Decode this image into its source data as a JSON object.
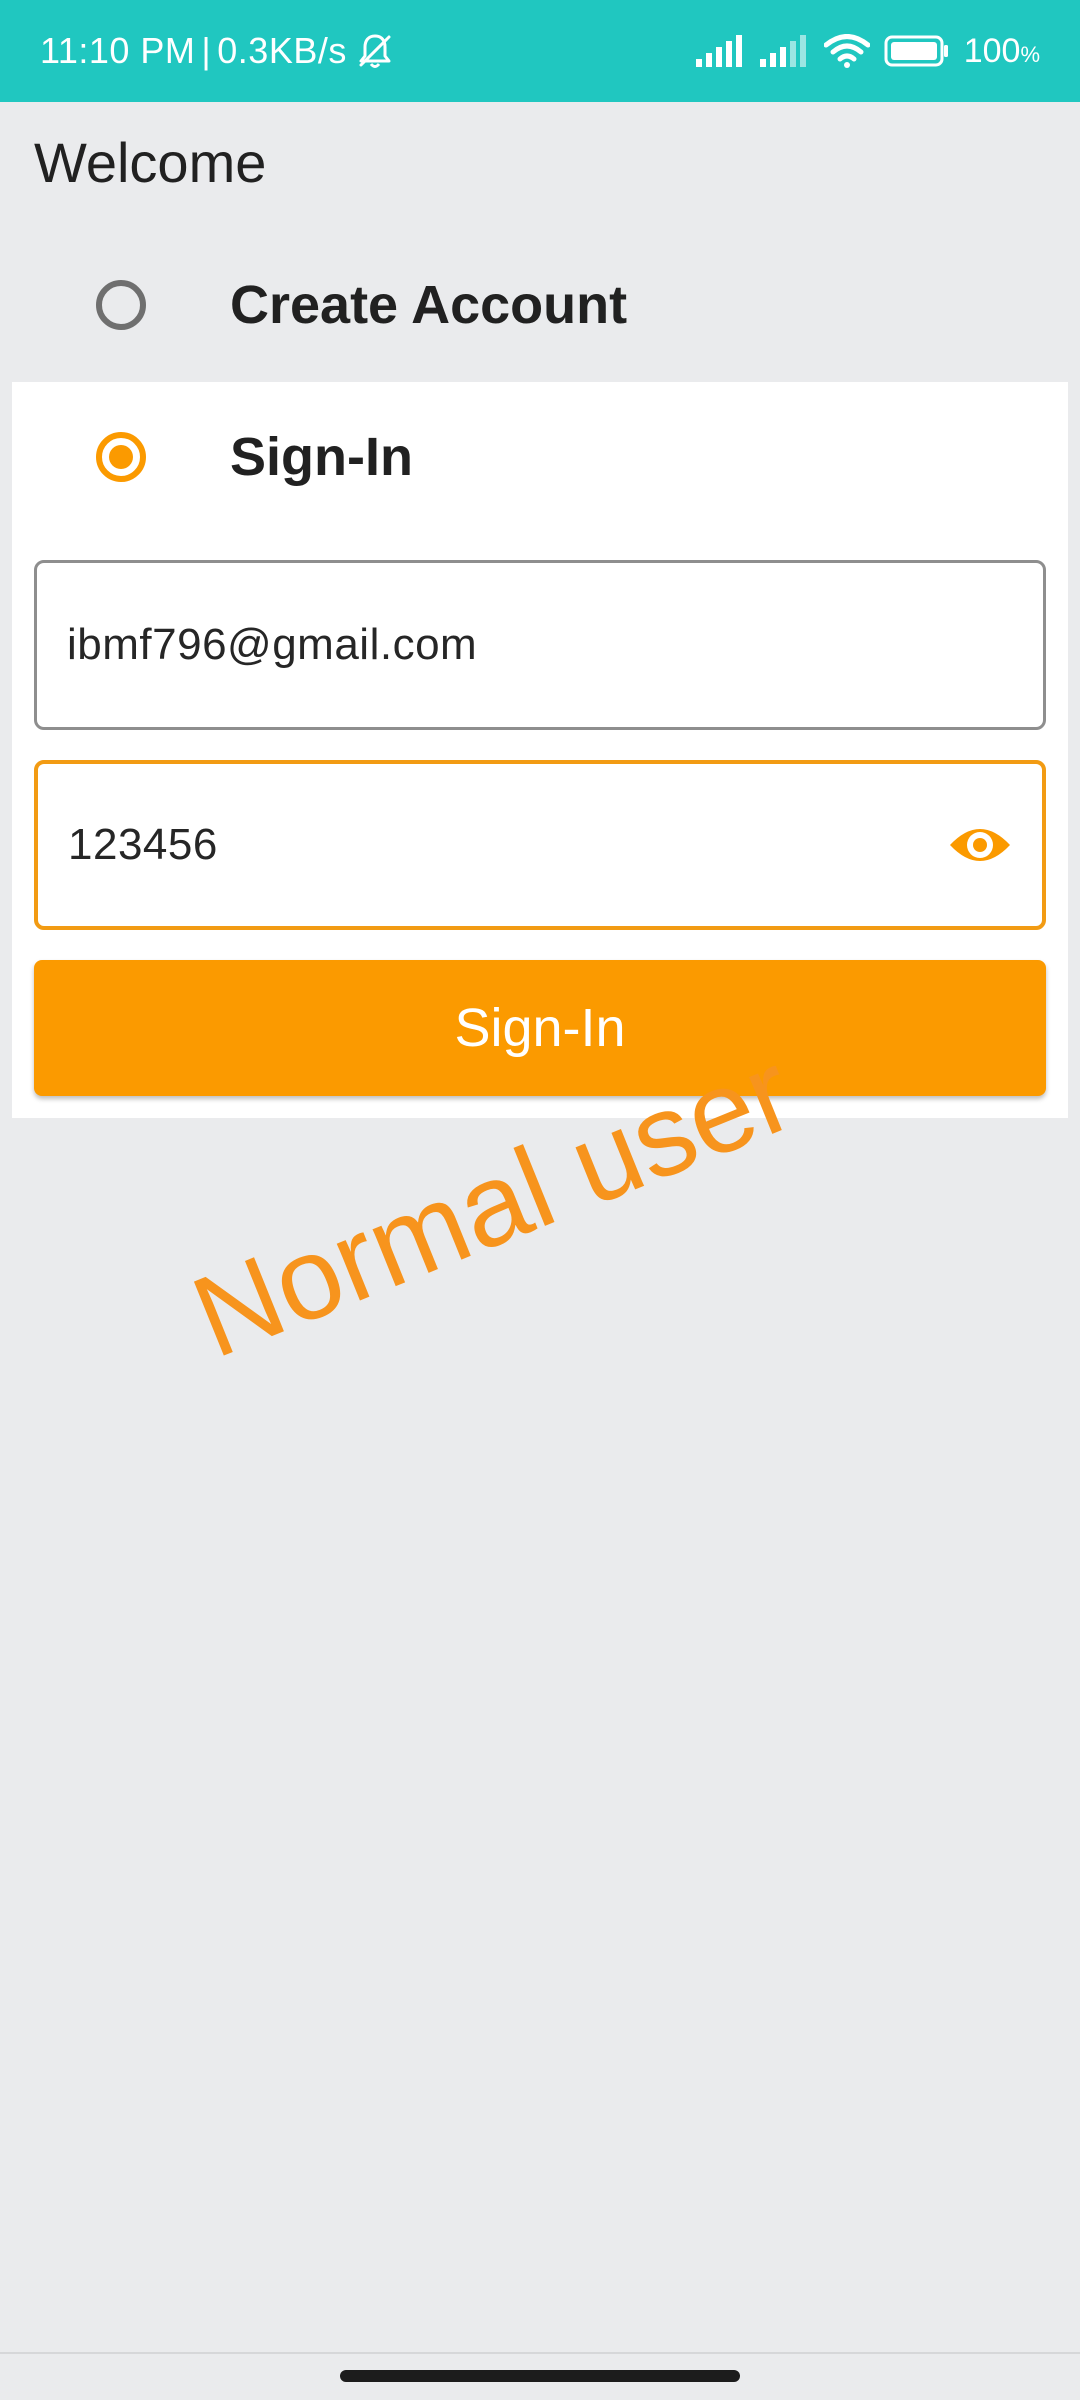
{
  "status_bar": {
    "time": "11:10 PM",
    "separator": "|",
    "network_speed": "0.3KB/s",
    "battery_percent": "100",
    "battery_unit": "%",
    "icons": [
      "bell-off-icon",
      "signal-icon",
      "signal-icon",
      "wifi-icon",
      "battery-icon"
    ]
  },
  "page": {
    "title": "Welcome"
  },
  "options": {
    "create_account": {
      "label": "Create Account",
      "selected": false
    },
    "sign_in": {
      "label": "Sign-In",
      "selected": true
    }
  },
  "form": {
    "email_value": "ibmf796@gmail.com",
    "password_value": "123456",
    "password_toggle_icon": "eye-icon",
    "submit_label": "Sign-In"
  },
  "annotation": {
    "text": "Normal user"
  },
  "colors": {
    "status_bar": "#20c7c0",
    "accent": "#fb9a00",
    "background": "#eaebed",
    "annotation": "#f7941d"
  }
}
